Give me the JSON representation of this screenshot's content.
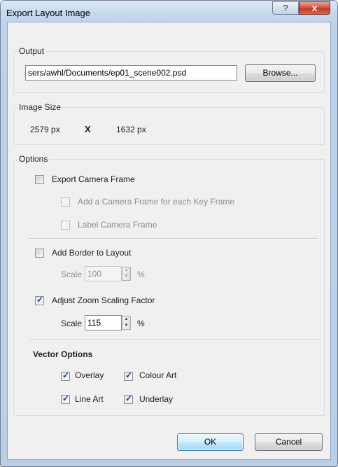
{
  "window": {
    "title": "Export Layout Image",
    "help_label": "?",
    "close_label": "x"
  },
  "output": {
    "label": "Output",
    "path": "sers/awhl/Documents/ep01_scene002.psd",
    "browse_label": "Browse..."
  },
  "image_size": {
    "label": "Image Size",
    "width": "2579 px",
    "separator": "X",
    "height": "1632 px"
  },
  "options": {
    "label": "Options",
    "export_camera_frame": {
      "label": "Export Camera Frame",
      "checked": false
    },
    "camera_frame_each_key": {
      "label": "Add a Camera Frame for each Key Frame",
      "checked": false,
      "enabled": false
    },
    "label_camera_frame": {
      "label": "Label Camera Frame",
      "checked": false,
      "enabled": false
    },
    "add_border": {
      "label": "Add Border to Layout",
      "checked": false
    },
    "border_scale": {
      "label": "Scale",
      "value": "100",
      "unit": "%",
      "enabled": false
    },
    "adjust_zoom": {
      "label": "Adjust Zoom Scaling Factor",
      "checked": true
    },
    "zoom_scale": {
      "label": "Scale",
      "value": "115",
      "unit": "%",
      "enabled": true
    },
    "vector_options": {
      "title": "Vector Options",
      "overlay": {
        "label": "Overlay",
        "checked": true
      },
      "colour_art": {
        "label": "Colour Art",
        "checked": true
      },
      "line_art": {
        "label": "Line Art",
        "checked": true
      },
      "underlay": {
        "label": "Underlay",
        "checked": true
      }
    }
  },
  "footer": {
    "ok_label": "OK",
    "cancel_label": "Cancel"
  },
  "icons": {
    "checkmark": "check-icon",
    "spin_up": "arrow-up-icon",
    "spin_down": "arrow-down-icon"
  },
  "colors": {
    "frame": "#bed3ea",
    "client": "#f0f0f0",
    "close_button": "#c33a22",
    "checkmark": "#1f3f86",
    "default_button_border": "#3c7fb1"
  }
}
